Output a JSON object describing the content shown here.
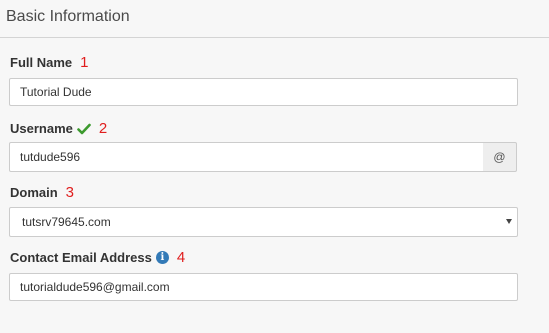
{
  "section": {
    "title": "Basic Information"
  },
  "fields": {
    "full_name": {
      "label": "Full Name",
      "annotation": "1",
      "value": "Tutorial Dude"
    },
    "username": {
      "label": "Username",
      "annotation": "2",
      "value": "tutdude596",
      "addon": "@",
      "status_icon": "check-icon",
      "status_color": "#3c9a2e"
    },
    "domain": {
      "label": "Domain",
      "annotation": "3",
      "selected": "tutsrv79645.com",
      "icon": "chevron-down-icon"
    },
    "email": {
      "label": "Contact Email Address",
      "annotation": "4",
      "value": "tutorialdude596@gmail.com",
      "info_icon": "info-icon",
      "info_glyph": "i",
      "info_color": "#337ab7"
    }
  },
  "colors": {
    "annotation": "#e01e1e",
    "background": "#f7f7f7",
    "input_border": "#cccccc",
    "addon_bg": "#eeeeee"
  }
}
